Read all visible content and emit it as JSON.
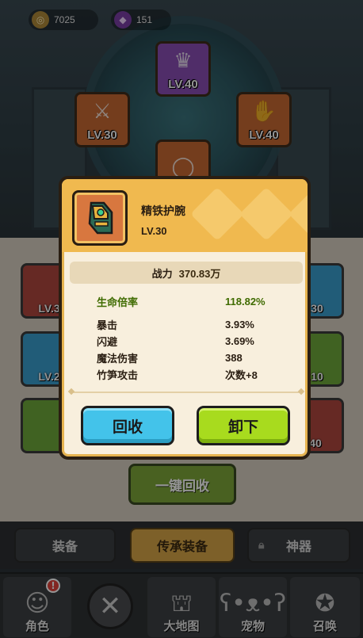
{
  "hud": {
    "gold": "7025",
    "gems": "151"
  },
  "equipped_slots": [
    {
      "level": "LV.40"
    },
    {
      "level": "LV.30"
    },
    {
      "level": "LV.40"
    }
  ],
  "bag_tiles": [
    {
      "level": "LV.3"
    },
    {
      "level": ".30"
    },
    {
      "level": "LV.2"
    },
    {
      "level": ".10"
    },
    {
      "level": "40"
    }
  ],
  "one_key_recycle": "一键回收",
  "tabs": {
    "equipment": "装备",
    "inherit": "传承装备",
    "artifact": "神器"
  },
  "nav": {
    "role": "角色",
    "role_badge": "!",
    "world_map": "大地图",
    "pet": "宠物",
    "summon": "召唤"
  },
  "popup": {
    "item_name": "精铁护腕",
    "item_level": "LV.30",
    "power_label": "战力",
    "power_value": "370.83万",
    "main_stat": {
      "name": "生命倍率",
      "value": "118.82%"
    },
    "sub_stats": [
      {
        "name": "暴击",
        "value": "3.93%"
      },
      {
        "name": "闪避",
        "value": "3.69%"
      },
      {
        "name": "魔法伤害",
        "value": "388"
      },
      {
        "name": "竹笋攻击",
        "value": "次数+8"
      }
    ],
    "recycle_button": "回收",
    "unequip_button": "卸下"
  },
  "colors": {
    "popup_bg": "#f8efdd",
    "popup_header": "#f0b94f",
    "main_stat": "#3f6b00",
    "recycle_button": "#43c3ea",
    "unequip_button": "#a8db1e"
  },
  "icons": {
    "gold": "gold-coin-icon",
    "gem": "gem-icon",
    "item": "bracer-icon",
    "lock": "lock-icon",
    "close": "close-icon",
    "role": "character-icon",
    "map": "map-icon",
    "pet": "pet-icon",
    "summon": "summon-icon"
  }
}
